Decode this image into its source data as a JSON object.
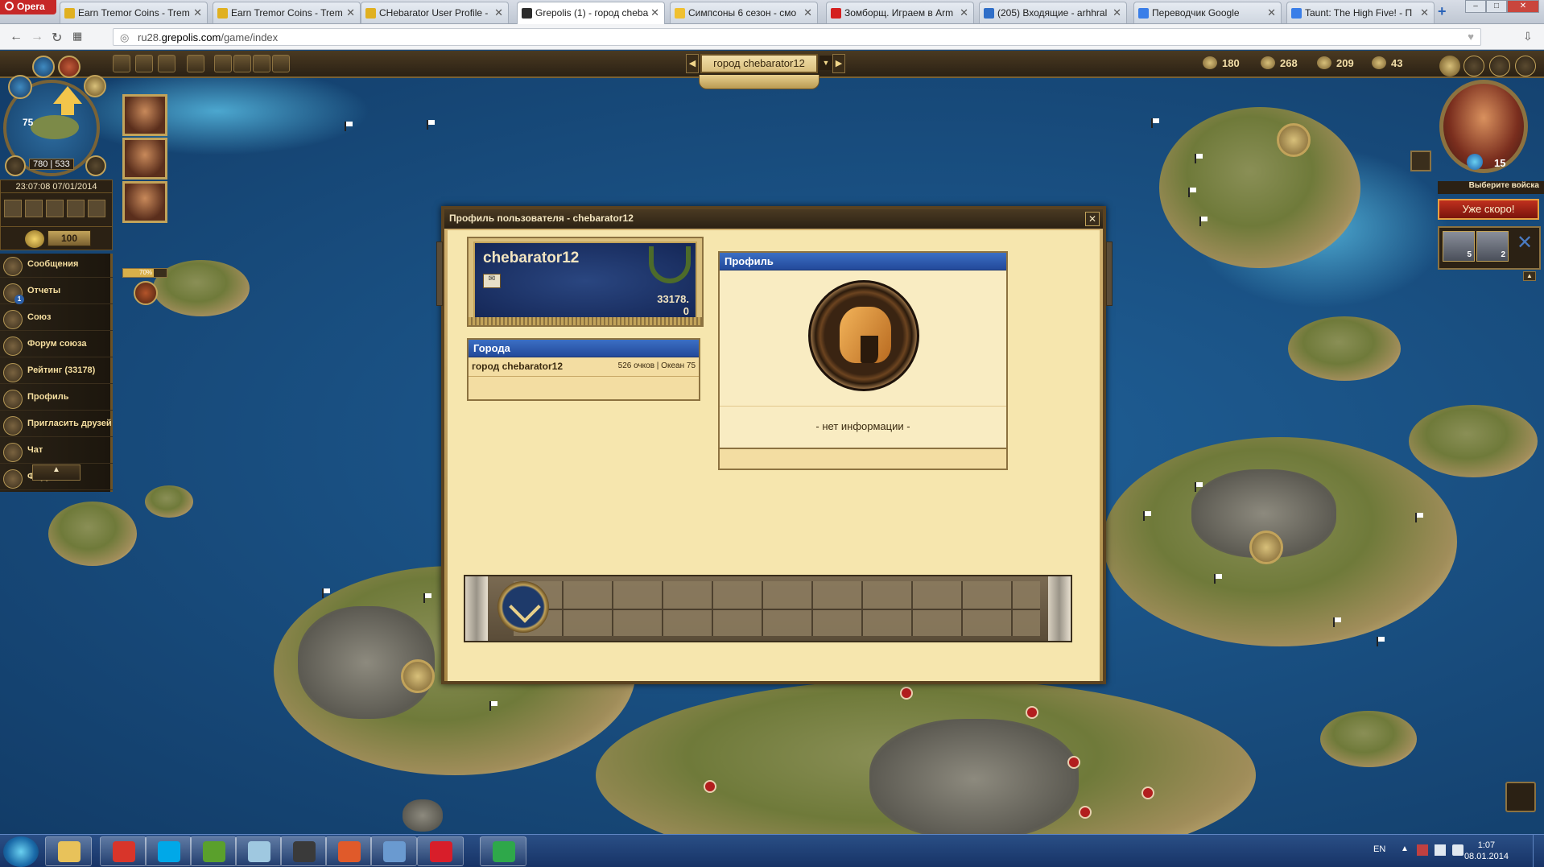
{
  "browser": {
    "menu_label": "Opera",
    "tabs": [
      {
        "title": "Earn Tremor Coins - Trem",
        "icon_color": "#e0b020"
      },
      {
        "title": "Earn Tremor Coins - Trem",
        "icon_color": "#e0b020"
      },
      {
        "title": "CHebarator User Profile -",
        "icon_color": "#e0b020"
      },
      {
        "title": "Grepolis (1) - город cheba",
        "icon_color": "#2c2c2c",
        "active": true
      },
      {
        "title": "Симпсоны 6 сезон - смо",
        "icon_color": "#f0c030"
      },
      {
        "title": "Зомборщ. Играем в Arm",
        "icon_color": "#d42020"
      },
      {
        "title": "(205) Входящие - arhhral",
        "icon_color": "#2f6ec8"
      },
      {
        "title": "Переводчик Google",
        "icon_color": "#3a7ee8"
      },
      {
        "title": "Taunt: The High Five! - П",
        "icon_color": "#3a7ee8"
      }
    ],
    "url_prefix": "ru28.",
    "url_domain": "grepolis.com",
    "url_path": "/game/index"
  },
  "game": {
    "city_selector": "город chebarator12",
    "resources": [
      {
        "icon": "wood-icon",
        "value": "180"
      },
      {
        "icon": "stone-icon",
        "value": "268"
      },
      {
        "icon": "silver-icon",
        "value": "209"
      },
      {
        "icon": "population-icon",
        "value": "43"
      }
    ],
    "island_level": "75",
    "coords_x": "780",
    "coords_y": "533",
    "server_time": "23:07:08 07/01/2014",
    "gold": "100",
    "progress_label": "70%",
    "progress_value": 0.7,
    "menu": [
      {
        "label": "Сообщения",
        "icon": "messages-icon"
      },
      {
        "label": "Отчеты",
        "icon": "reports-icon",
        "badge": "1"
      },
      {
        "label": "Союз",
        "icon": "alliance-icon"
      },
      {
        "label": "Форум союза",
        "icon": "alliance-forum-icon"
      },
      {
        "label": "Рейтинг (33178)",
        "icon": "ranking-icon"
      },
      {
        "label": "Профиль",
        "icon": "profile-icon"
      },
      {
        "label": "Пригласить друзей",
        "icon": "invite-icon"
      },
      {
        "label": "Чат",
        "icon": "chat-icon"
      },
      {
        "label": "Форум",
        "icon": "forum-icon"
      }
    ],
    "favor": "15",
    "select_army": "Выберите войска",
    "coming_soon": "Уже скоро!",
    "units": [
      {
        "name": "hoplite",
        "count": "5"
      },
      {
        "name": "swordsman",
        "count": "2"
      }
    ]
  },
  "profile_window": {
    "title": "Профиль пользователя - chebarator12",
    "player_name": "chebarator12",
    "points_line1": "33178.",
    "points_line2": "0",
    "cities_header": "Города",
    "cities": [
      {
        "name": "город chebarator12",
        "info": "526 очков | Океан 75"
      }
    ],
    "profile_header": "Профиль",
    "no_info": "- нет информации -"
  },
  "taskbar": {
    "lang": "EN",
    "time": "1:07",
    "date": "08.01.2014",
    "apps": [
      {
        "name": "explorer",
        "color": "#e8c25a"
      },
      {
        "name": "chrome",
        "color": "#d8352a"
      },
      {
        "name": "skype",
        "color": "#00a8e8"
      },
      {
        "name": "utorrent",
        "color": "#5aa02c"
      },
      {
        "name": "notes",
        "color": "#9fc8e0"
      },
      {
        "name": "steam",
        "color": "#3a3a3a"
      },
      {
        "name": "speaker",
        "color": "#e05a2a"
      },
      {
        "name": "network",
        "color": "#6a9ad0"
      },
      {
        "name": "opera",
        "color": "#d81e2a"
      },
      {
        "name": "hangouts",
        "color": "#2ea84a"
      }
    ]
  }
}
